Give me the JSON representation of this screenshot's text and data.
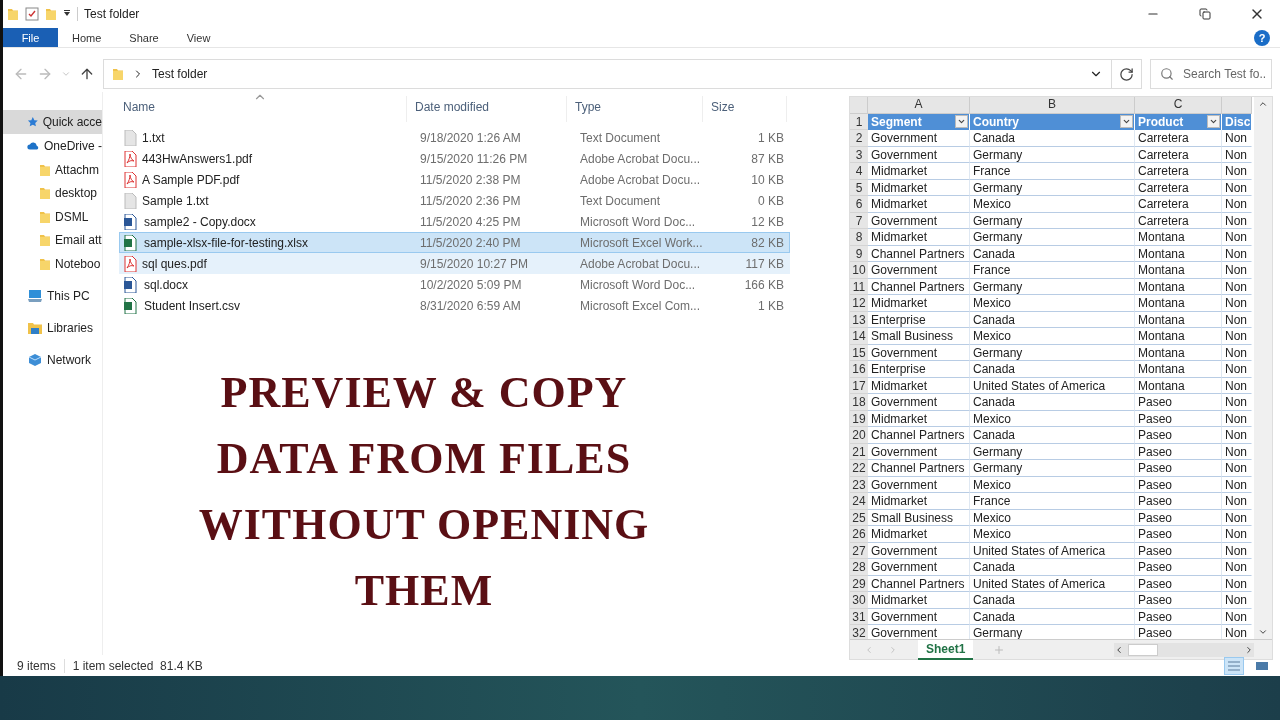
{
  "window": {
    "title": "Test folder",
    "help": "?"
  },
  "ribbon_tabs": [
    {
      "label": "File",
      "selected": true
    },
    {
      "label": "Home",
      "selected": false
    },
    {
      "label": "Share",
      "selected": false
    },
    {
      "label": "View",
      "selected": false
    }
  ],
  "address": {
    "path": "Test folder",
    "search_placeholder": "Search Test fo..."
  },
  "nav": [
    {
      "label": "Quick acce",
      "kind": "star",
      "selected": true
    },
    {
      "label": "OneDrive -",
      "kind": "cloud",
      "selected": false,
      "children": [
        {
          "label": "Attachm",
          "kind": "folder",
          "selected": false
        },
        {
          "label": "desktop",
          "kind": "folder",
          "selected": false
        },
        {
          "label": "DSML",
          "kind": "folder",
          "selected": false
        },
        {
          "label": "Email att",
          "kind": "folder",
          "selected": false
        },
        {
          "label": "Noteboo",
          "kind": "folder",
          "selected": false
        }
      ]
    },
    {
      "label": "This PC",
      "kind": "pc",
      "selected": false
    },
    {
      "label": "Libraries",
      "kind": "library",
      "selected": false
    },
    {
      "label": "Network",
      "kind": "network",
      "selected": false
    }
  ],
  "file_list": {
    "columns": [
      "Name",
      "Date modified",
      "Type",
      "Size"
    ],
    "rows": [
      {
        "name": "1.txt",
        "date": "9/18/2020 1:26 AM",
        "type": "Text Document",
        "size": "1 KB",
        "kind": "txt",
        "selected": false,
        "hovered": false
      },
      {
        "name": "443HwAnswers1.pdf",
        "date": "9/15/2020 11:26 PM",
        "type": "Adobe Acrobat Docu...",
        "size": "87 KB",
        "kind": "pdf",
        "selected": false,
        "hovered": false
      },
      {
        "name": "A Sample PDF.pdf",
        "date": "11/5/2020 2:38 PM",
        "type": "Adobe Acrobat Docu...",
        "size": "10 KB",
        "kind": "pdf",
        "selected": false,
        "hovered": false
      },
      {
        "name": "Sample 1.txt",
        "date": "11/5/2020 2:36 PM",
        "type": "Text Document",
        "size": "0 KB",
        "kind": "txt",
        "selected": false,
        "hovered": false
      },
      {
        "name": "sample2 - Copy.docx",
        "date": "11/5/2020 4:25 PM",
        "type": "Microsoft Word Doc...",
        "size": "12 KB",
        "kind": "word",
        "selected": false,
        "hovered": false
      },
      {
        "name": "sample-xlsx-file-for-testing.xlsx",
        "date": "11/5/2020 2:40 PM",
        "type": "Microsoft Excel Work...",
        "size": "82 KB",
        "kind": "excel",
        "selected": true,
        "hovered": false
      },
      {
        "name": "sql ques.pdf",
        "date": "9/15/2020 10:27 PM",
        "type": "Adobe Acrobat Docu...",
        "size": "117 KB",
        "kind": "pdf",
        "selected": false,
        "hovered": true
      },
      {
        "name": "sql.docx",
        "date": "10/2/2020 5:09 PM",
        "type": "Microsoft Word Doc...",
        "size": "166 KB",
        "kind": "word",
        "selected": false,
        "hovered": false
      },
      {
        "name": "Student Insert.csv",
        "date": "8/31/2020 6:59 AM",
        "type": "Microsoft Excel Com...",
        "size": "1 KB",
        "kind": "excel",
        "selected": false,
        "hovered": false
      }
    ]
  },
  "overlay_title": [
    "PREVIEW & COPY",
    "DATA FROM FILES",
    "WITHOUT OPENING",
    "THEM"
  ],
  "preview": {
    "column_letters": [
      "A",
      "B",
      "C"
    ],
    "header": {
      "number": "1",
      "cells": [
        "Segment",
        "Country",
        "Product",
        "Disc"
      ]
    },
    "rows": [
      [
        "2",
        "Government",
        "Canada",
        "Carretera",
        "Non"
      ],
      [
        "3",
        "Government",
        "Germany",
        "Carretera",
        "Non"
      ],
      [
        "4",
        "Midmarket",
        "France",
        "Carretera",
        "Non"
      ],
      [
        "5",
        "Midmarket",
        "Germany",
        "Carretera",
        "Non"
      ],
      [
        "6",
        "Midmarket",
        "Mexico",
        "Carretera",
        "Non"
      ],
      [
        "7",
        "Government",
        "Germany",
        "Carretera",
        "Non"
      ],
      [
        "8",
        "Midmarket",
        "Germany",
        "Montana",
        "Non"
      ],
      [
        "9",
        "Channel Partners",
        "Canada",
        "Montana",
        "Non"
      ],
      [
        "10",
        "Government",
        "France",
        "Montana",
        "Non"
      ],
      [
        "11",
        "Channel Partners",
        "Germany",
        "Montana",
        "Non"
      ],
      [
        "12",
        "Midmarket",
        "Mexico",
        "Montana",
        "Non"
      ],
      [
        "13",
        "Enterprise",
        "Canada",
        "Montana",
        "Non"
      ],
      [
        "14",
        "Small Business",
        "Mexico",
        "Montana",
        "Non"
      ],
      [
        "15",
        "Government",
        "Germany",
        "Montana",
        "Non"
      ],
      [
        "16",
        "Enterprise",
        "Canada",
        "Montana",
        "Non"
      ],
      [
        "17",
        "Midmarket",
        "United States of America",
        "Montana",
        "Non"
      ],
      [
        "18",
        "Government",
        "Canada",
        "Paseo",
        "Non"
      ],
      [
        "19",
        "Midmarket",
        "Mexico",
        "Paseo",
        "Non"
      ],
      [
        "20",
        "Channel Partners",
        "Canada",
        "Paseo",
        "Non"
      ],
      [
        "21",
        "Government",
        "Germany",
        "Paseo",
        "Non"
      ],
      [
        "22",
        "Channel Partners",
        "Germany",
        "Paseo",
        "Non"
      ],
      [
        "23",
        "Government",
        "Mexico",
        "Paseo",
        "Non"
      ],
      [
        "24",
        "Midmarket",
        "France",
        "Paseo",
        "Non"
      ],
      [
        "25",
        "Small Business",
        "Mexico",
        "Paseo",
        "Non"
      ],
      [
        "26",
        "Midmarket",
        "Mexico",
        "Paseo",
        "Non"
      ],
      [
        "27",
        "Government",
        "United States of America",
        "Paseo",
        "Non"
      ],
      [
        "28",
        "Government",
        "Canada",
        "Paseo",
        "Non"
      ],
      [
        "29",
        "Channel Partners",
        "United States of America",
        "Paseo",
        "Non"
      ],
      [
        "30",
        "Midmarket",
        "Canada",
        "Paseo",
        "Non"
      ],
      [
        "31",
        "Government",
        "Canada",
        "Paseo",
        "Non"
      ],
      [
        "32",
        "Government",
        "Germany",
        "Paseo",
        "Non"
      ]
    ],
    "sheet_tab": "Sheet1"
  },
  "status_bar": {
    "item_count": "9 items",
    "selection": "1 item selected  81.4 KB"
  }
}
